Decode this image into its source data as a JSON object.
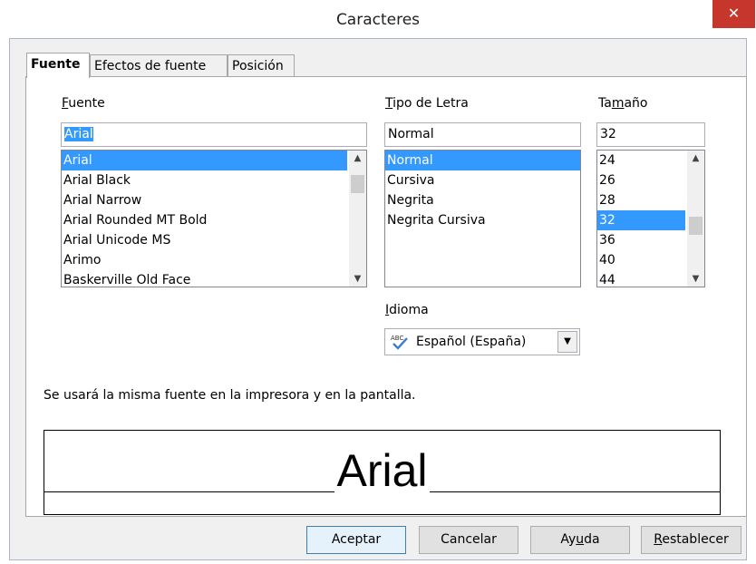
{
  "window": {
    "title": "Caracteres",
    "close_glyph": "✕"
  },
  "tabs": [
    {
      "label": "Fuente",
      "active": true
    },
    {
      "label": "Efectos de fuente",
      "active": false
    },
    {
      "label": "Posición",
      "active": false
    }
  ],
  "font": {
    "label_first": "F",
    "label_rest": "uente",
    "value": "Arial",
    "items": [
      "Arial",
      "Arial Black",
      "Arial Narrow",
      "Arial Rounded MT Bold",
      "Arial Unicode MS",
      "Arimo",
      "Baskerville Old Face"
    ],
    "selected": "Arial"
  },
  "style": {
    "label_first": "T",
    "label_rest": "ipo de Letra",
    "value": "Normal",
    "items": [
      "Normal",
      "Cursiva",
      "Negrita",
      "Negrita Cursiva"
    ],
    "selected": "Normal"
  },
  "size": {
    "label_pre": "Ta",
    "label_u": "m",
    "label_post": "año",
    "value": "32",
    "items": [
      "24",
      "26",
      "28",
      "32",
      "36",
      "40",
      "44"
    ],
    "selected": "32"
  },
  "language": {
    "label_first": "I",
    "label_rest": "dioma",
    "value": "Español (España)",
    "icon": "spellcheck-icon"
  },
  "info_text": "Se usará la misma fuente en la impresora y en la pantalla.",
  "preview_text": "Arial",
  "buttons": {
    "ok": "Aceptar",
    "cancel": "Cancelar",
    "help_pre": "Ay",
    "help_u": "u",
    "help_post": "da",
    "reset_first": "R",
    "reset_rest": "establecer"
  },
  "colors": {
    "selection": "#3399ff",
    "close": "#c7362d"
  }
}
